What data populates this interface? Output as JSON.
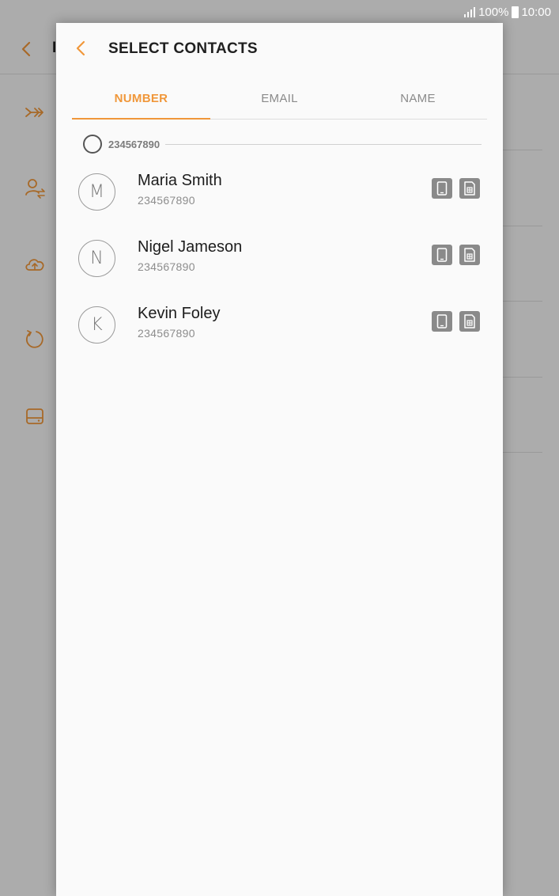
{
  "status_bar": {
    "battery": "100%",
    "time": "10:00"
  },
  "background_app": {
    "title": "I",
    "icons": [
      "transfer-icon",
      "person-sync-icon",
      "cloud-upload-icon",
      "refresh-icon",
      "storage-icon"
    ]
  },
  "dialog": {
    "title": "SELECT CONTACTS",
    "tabs": [
      {
        "label": "NUMBER",
        "active": true
      },
      {
        "label": "EMAIL",
        "active": false
      },
      {
        "label": "NAME",
        "active": false
      }
    ],
    "group": {
      "label": "234567890",
      "selected": false
    },
    "contacts": [
      {
        "initial": "M",
        "name": "Maria Smith",
        "number": "234567890",
        "storage": [
          "phone-icon",
          "sim-icon"
        ]
      },
      {
        "initial": "N",
        "name": "Nigel Jameson",
        "number": "234567890",
        "storage": [
          "phone-icon",
          "sim-icon"
        ]
      },
      {
        "initial": "K",
        "name": "Kevin Foley",
        "number": "234567890",
        "storage": [
          "phone-icon",
          "sim-icon"
        ]
      }
    ]
  },
  "colors": {
    "accent": "#f0973a",
    "scrim": "rgba(0,0,0,0.30)",
    "store_icon_bg": "#8a8a8a"
  }
}
